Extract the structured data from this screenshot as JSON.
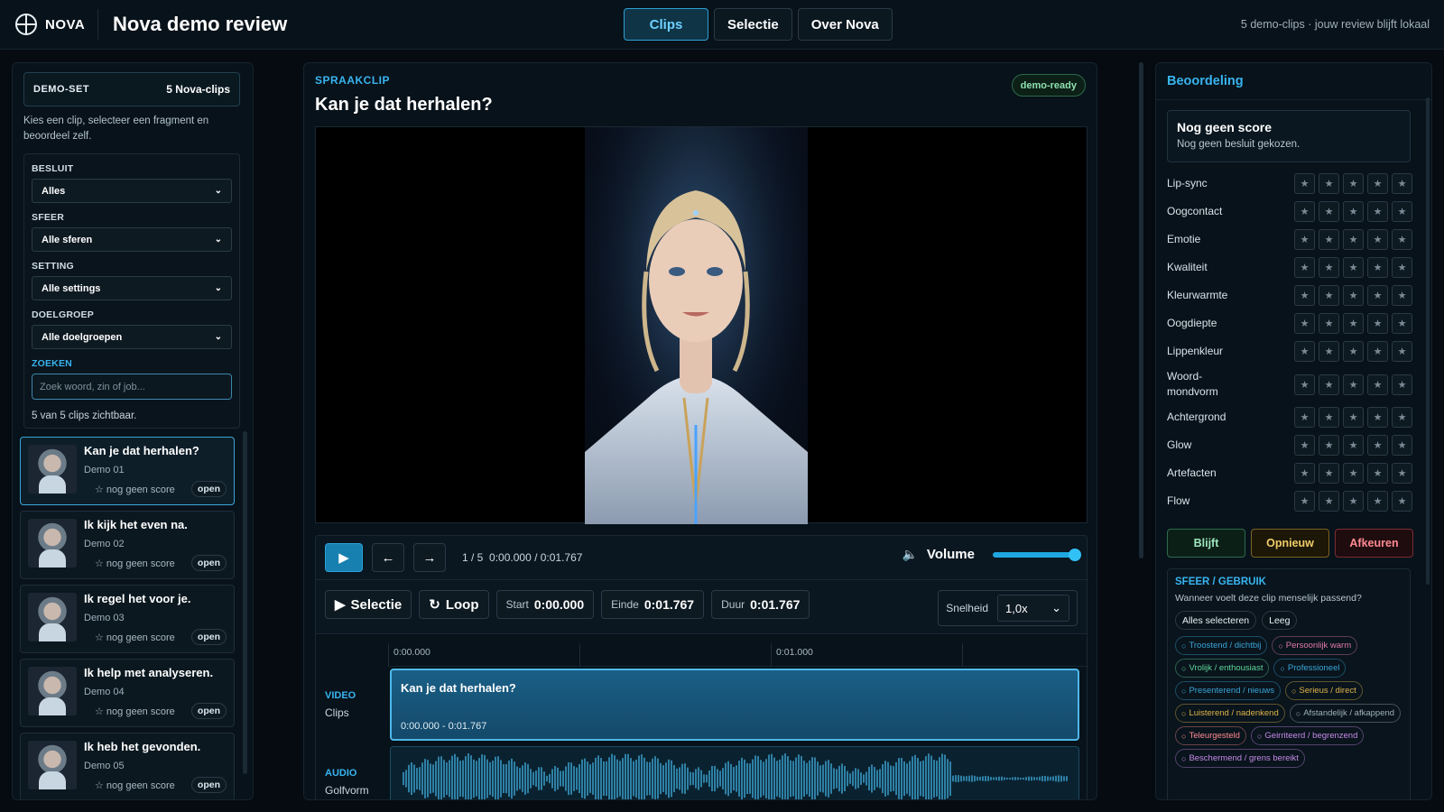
{
  "topbar": {
    "logo_text": "NOVA",
    "title": "Nova demo review",
    "nav": [
      {
        "label": "Clips",
        "active": true
      },
      {
        "label": "Selectie",
        "active": false
      },
      {
        "label": "Over Nova",
        "active": false
      }
    ],
    "status": "5 demo-clips · jouw review blijft lokaal"
  },
  "left": {
    "demoset_label": "DEMO-SET",
    "demoset_value": "5 Nova-clips",
    "intro": "Kies een clip, selecteer een fragment en beoordeel zelf.",
    "filters": {
      "besluit_label": "BESLUIT",
      "besluit_value": "Alles",
      "sfeer_label": "SFEER",
      "sfeer_value": "Alle sferen",
      "setting_label": "SETTING",
      "setting_value": "Alle settings",
      "doelgroep_label": "DOELGROEP",
      "doelgroep_value": "Alle doelgroepen",
      "zoeken_label": "ZOEKEN",
      "zoeken_placeholder": "Zoek woord, zin of job..."
    },
    "count": "5 van 5 clips zichtbaar.",
    "clips": [
      {
        "title": "Kan je dat herhalen?",
        "sub": "Demo 01",
        "score": "nog geen score",
        "open": "open",
        "active": true
      },
      {
        "title": "Ik kijk het even na.",
        "sub": "Demo 02",
        "score": "nog geen score",
        "open": "open"
      },
      {
        "title": "Ik regel het voor je.",
        "sub": "Demo 03",
        "score": "nog geen score",
        "open": "open"
      },
      {
        "title": "Ik help met analyseren.",
        "sub": "Demo 04",
        "score": "nog geen score",
        "open": "open"
      },
      {
        "title": "Ik heb het gevonden.",
        "sub": "Demo 05",
        "score": "nog geen score",
        "open": "open"
      }
    ]
  },
  "center": {
    "kicker": "SPRAAKCLIP",
    "title": "Kan je dat herhalen?",
    "badge": "demo-ready",
    "player": {
      "position": "1 / 5",
      "time": "0:00.000 / 0:01.767",
      "volume_label": "Volume",
      "volume": 1.0
    },
    "selection": {
      "selectie_label": "Selectie",
      "loop_label": "Loop",
      "start_label": "Start",
      "start_value": "0:00.000",
      "einde_label": "Einde",
      "einde_value": "0:01.767",
      "duur_label": "Duur",
      "duur_value": "0:01.767",
      "speed_label": "Snelheid",
      "speed_value": "1,0x"
    },
    "timeline": {
      "tick_0": "0:00.000",
      "tick_1": "0:01.000",
      "video_label": "VIDEO",
      "video_sub": "Clips",
      "video_block_title": "Kan je dat herhalen?",
      "video_block_range": "0:00.000 - 0:01.767",
      "audio_label": "AUDIO",
      "audio_sub": "Golfvorm"
    }
  },
  "right": {
    "title": "Beoordeling",
    "score_title": "Nog geen score",
    "score_sub": "Nog geen besluit gekozen.",
    "ratings": [
      {
        "label": "Lip-sync",
        "value": 0
      },
      {
        "label": "Oogcontact",
        "value": 0
      },
      {
        "label": "Emotie",
        "value": 0
      },
      {
        "label": "Kwaliteit",
        "value": 0
      },
      {
        "label": "Kleurwarmte",
        "value": 0
      },
      {
        "label": "Oogdiepte",
        "value": 0
      },
      {
        "label": "Lippenkleur",
        "value": 0
      },
      {
        "label": "Woord-mondvorm",
        "value": 0
      },
      {
        "label": "Achtergrond",
        "value": 0
      },
      {
        "label": "Glow",
        "value": 0
      },
      {
        "label": "Artefacten",
        "value": 0
      },
      {
        "label": "Flow",
        "value": 0
      }
    ],
    "decision": {
      "keep": "Blijft",
      "redo": "Opnieuw",
      "reject": "Afkeuren"
    },
    "sfeer_title": "SFEER / GEBRUIK",
    "sfeer_sub": "Wanneer voelt deze clip menselijk passend?",
    "select_all": "Alles selecteren",
    "clear": "Leeg",
    "chips": [
      {
        "label": "Troostend / dichtbij",
        "color": "#3aa6d8"
      },
      {
        "label": "Persoonlijk warm",
        "color": "#e07aa8"
      },
      {
        "label": "Vrolijk / enthousiast",
        "color": "#5fd69a"
      },
      {
        "label": "Professioneel",
        "color": "#3aa6d8"
      },
      {
        "label": "Presenterend / nieuws",
        "color": "#3aa6d8"
      },
      {
        "label": "Serieus / direct",
        "color": "#e0b44a"
      },
      {
        "label": "Luisterend / nadenkend",
        "color": "#e0b44a"
      },
      {
        "label": "Afstandelijk / afkappend",
        "color": "#9fb0bb"
      },
      {
        "label": "Teleurgesteld",
        "color": "#ff8a92"
      },
      {
        "label": "Geirriteerd / begrenzend",
        "color": "#c68ae8"
      },
      {
        "label": "Beschermend / grens bereikt",
        "color": "#c68ae8"
      }
    ]
  }
}
